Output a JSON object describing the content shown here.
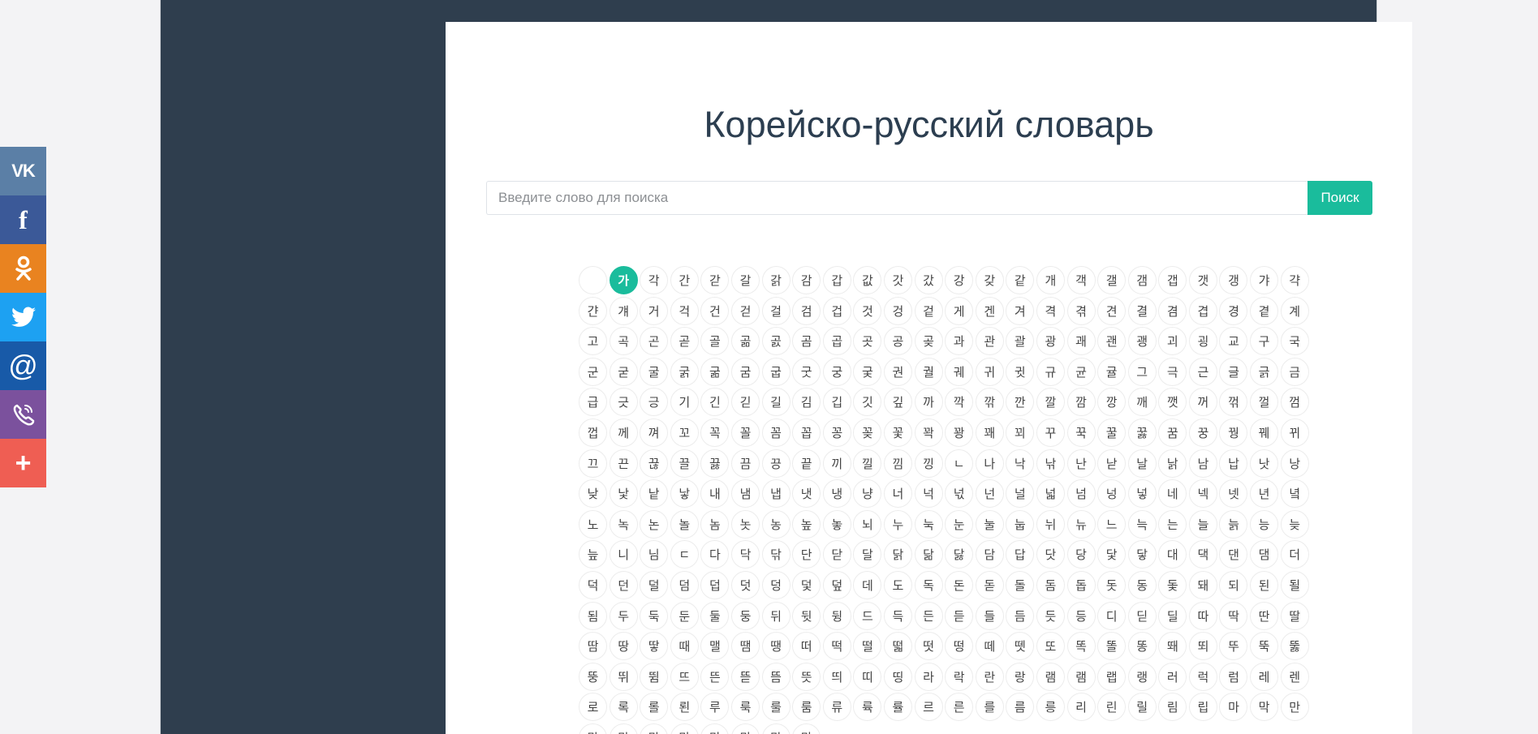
{
  "header": {
    "title": "Корейско-русский словарь"
  },
  "search": {
    "placeholder": "Введите слово для поиска",
    "value": "",
    "button_label": "Поиск"
  },
  "share": {
    "items": [
      {
        "name": "vk",
        "label": "VK",
        "icon": "vk-icon",
        "color": "#5b7fa6"
      },
      {
        "name": "facebook",
        "label": "f",
        "icon": "facebook-icon",
        "color": "#3b5998"
      },
      {
        "name": "odnoklassniki",
        "label": "",
        "icon": "odnoklassniki-icon",
        "color": "#e98320"
      },
      {
        "name": "twitter",
        "label": "",
        "icon": "twitter-icon",
        "color": "#1da1f2"
      },
      {
        "name": "mail",
        "label": "@",
        "icon": "at-icon",
        "color": "#185aa8"
      },
      {
        "name": "viber",
        "label": "",
        "icon": "viber-icon",
        "color": "#7b519d"
      },
      {
        "name": "more",
        "label": "+",
        "icon": "plus-icon",
        "color": "#ef5e53"
      }
    ]
  },
  "alphabet": {
    "active_index": 1,
    "syllables": [
      "",
      "가",
      "각",
      "간",
      "갇",
      "갈",
      "갉",
      "감",
      "갑",
      "값",
      "갓",
      "갔",
      "강",
      "갖",
      "같",
      "개",
      "객",
      "갤",
      "갬",
      "갭",
      "갯",
      "갱",
      "갸",
      "갹",
      "갼",
      "걔",
      "거",
      "걱",
      "건",
      "걷",
      "걸",
      "검",
      "겁",
      "것",
      "겅",
      "겉",
      "게",
      "겐",
      "겨",
      "격",
      "겪",
      "견",
      "결",
      "겸",
      "겹",
      "경",
      "곁",
      "계",
      "고",
      "곡",
      "곤",
      "곧",
      "골",
      "곪",
      "곬",
      "곰",
      "곱",
      "곳",
      "공",
      "곶",
      "과",
      "관",
      "괄",
      "광",
      "괘",
      "괜",
      "괭",
      "괴",
      "굉",
      "교",
      "구",
      "국",
      "군",
      "굳",
      "굴",
      "굵",
      "굶",
      "굼",
      "굽",
      "굿",
      "궁",
      "궂",
      "권",
      "궐",
      "궤",
      "귀",
      "귓",
      "규",
      "균",
      "귤",
      "그",
      "극",
      "근",
      "글",
      "긁",
      "금",
      "급",
      "긋",
      "긍",
      "기",
      "긴",
      "긷",
      "길",
      "김",
      "깁",
      "깃",
      "깊",
      "까",
      "깍",
      "깎",
      "깐",
      "깔",
      "깜",
      "깡",
      "깨",
      "깻",
      "꺼",
      "꺾",
      "껄",
      "껌",
      "껍",
      "께",
      "껴",
      "꼬",
      "꼭",
      "꼴",
      "꼼",
      "꼽",
      "꽁",
      "꽂",
      "꽃",
      "꽉",
      "꽝",
      "꽤",
      "꾀",
      "꾸",
      "꾹",
      "꿀",
      "꿇",
      "꿈",
      "꿍",
      "꿩",
      "꿰",
      "뀌",
      "끄",
      "끈",
      "끊",
      "끌",
      "끓",
      "끔",
      "끙",
      "끝",
      "끼",
      "낄",
      "낌",
      "낑",
      "ㄴ",
      "나",
      "낙",
      "낚",
      "난",
      "낟",
      "날",
      "낡",
      "남",
      "납",
      "낫",
      "낭",
      "낮",
      "낯",
      "낱",
      "낳",
      "내",
      "냄",
      "냅",
      "냇",
      "냉",
      "냥",
      "너",
      "넉",
      "넋",
      "넌",
      "널",
      "넓",
      "넘",
      "넝",
      "넣",
      "네",
      "넥",
      "넷",
      "년",
      "녘",
      "노",
      "녹",
      "논",
      "놀",
      "놈",
      "놋",
      "농",
      "높",
      "놓",
      "뇌",
      "누",
      "눅",
      "눈",
      "눌",
      "눕",
      "뉘",
      "뉴",
      "느",
      "늑",
      "는",
      "늘",
      "늙",
      "능",
      "늦",
      "늪",
      "니",
      "님",
      "ㄷ",
      "다",
      "닥",
      "닦",
      "단",
      "닫",
      "달",
      "닭",
      "닮",
      "닳",
      "담",
      "답",
      "닷",
      "당",
      "닻",
      "닿",
      "대",
      "댁",
      "댄",
      "댐",
      "더",
      "덕",
      "던",
      "덜",
      "덤",
      "덥",
      "덧",
      "덩",
      "덫",
      "덮",
      "데",
      "도",
      "독",
      "돈",
      "돋",
      "돌",
      "돔",
      "돕",
      "돗",
      "동",
      "돛",
      "돼",
      "되",
      "된",
      "될",
      "됨",
      "두",
      "둑",
      "둔",
      "둘",
      "둥",
      "뒤",
      "뒷",
      "뒹",
      "드",
      "득",
      "든",
      "듣",
      "들",
      "듬",
      "듯",
      "등",
      "디",
      "딛",
      "딜",
      "따",
      "딱",
      "딴",
      "딸",
      "땀",
      "땅",
      "땋",
      "때",
      "맬",
      "땜",
      "땡",
      "떠",
      "떡",
      "떨",
      "떫",
      "떳",
      "떵",
      "떼",
      "뗏",
      "또",
      "똑",
      "똘",
      "똥",
      "뙈",
      "뙤",
      "뚜",
      "뚝",
      "뚫",
      "뚱",
      "뛰",
      "뜀",
      "뜨",
      "뜬",
      "뜯",
      "뜸",
      "뜻",
      "띄",
      "띠",
      "띵",
      "라",
      "락",
      "란",
      "랑",
      "램",
      "램",
      "랩",
      "랭",
      "러",
      "럭",
      "럼",
      "레",
      "렌",
      "로",
      "록",
      "롤",
      "뢴",
      "루",
      "룩",
      "룰",
      "룸",
      "류",
      "륙",
      "률",
      "르",
      "른",
      "를",
      "름",
      "릉",
      "리",
      "린",
      "릴",
      "림",
      "립",
      "마",
      "막",
      "만",
      "많",
      "말",
      "맑",
      "맘",
      "맛",
      "망",
      "맞",
      "맡"
    ]
  }
}
